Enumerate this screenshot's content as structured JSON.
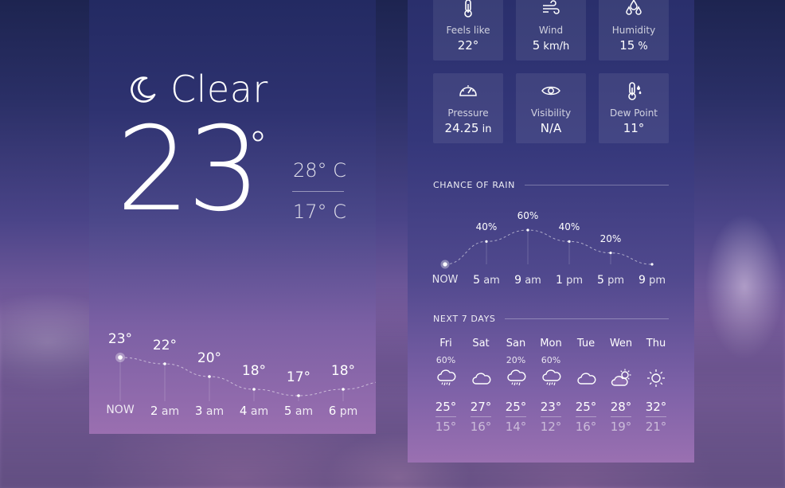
{
  "current": {
    "condition": "Clear",
    "icon": "moon-icon",
    "temperature": "23",
    "degree_symbol": "°",
    "high": "28° C",
    "low": "17° C"
  },
  "hourly": [
    {
      "temp": "23°",
      "time_num": "NOW",
      "time_unit": "",
      "value": 23
    },
    {
      "temp": "22°",
      "time_num": "2",
      "time_unit": "am",
      "value": 22
    },
    {
      "temp": "20°",
      "time_num": "3",
      "time_unit": "am",
      "value": 20
    },
    {
      "temp": "18°",
      "time_num": "4",
      "time_unit": "am",
      "value": 18
    },
    {
      "temp": "17°",
      "time_num": "5",
      "time_unit": "am",
      "value": 17
    },
    {
      "temp": "18°",
      "time_num": "6",
      "time_unit": "pm",
      "value": 18
    }
  ],
  "details": [
    {
      "label": "Feels like",
      "value": "22°",
      "unit": "",
      "icon": "thermometer-icon"
    },
    {
      "label": "Wind",
      "value": "5",
      "unit": "km/h",
      "icon": "wind-icon"
    },
    {
      "label": "Humidity",
      "value": "15",
      "unit": "%",
      "icon": "humidity-drops-icon"
    },
    {
      "label": "Pressure",
      "value": "24.25",
      "unit": "in",
      "icon": "gauge-icon"
    },
    {
      "label": "Visibility",
      "value": "N/A",
      "unit": "",
      "icon": "eye-icon"
    },
    {
      "label": "Dew Point",
      "value": "11°",
      "unit": "",
      "icon": "dew-thermometer-icon"
    }
  ],
  "rain": {
    "title": "CHANCE OF RAIN",
    "points": [
      {
        "label": "",
        "time_num": "NOW",
        "time_unit": "",
        "value": 0
      },
      {
        "label": "40%",
        "time_num": "5",
        "time_unit": "am",
        "value": 40
      },
      {
        "label": "60%",
        "time_num": "9",
        "time_unit": "am",
        "value": 60
      },
      {
        "label": "40%",
        "time_num": "1",
        "time_unit": "pm",
        "value": 40
      },
      {
        "label": "20%",
        "time_num": "5",
        "time_unit": "pm",
        "value": 20
      },
      {
        "label": "",
        "time_num": "9",
        "time_unit": "pm",
        "value": 0
      }
    ]
  },
  "week": {
    "title": "NEXT 7 DAYS",
    "days": [
      {
        "name": "Fri",
        "chance": "60%",
        "icon": "rain-cloud-icon",
        "hi": "25°",
        "lo": "15°"
      },
      {
        "name": "Sat",
        "chance": "",
        "icon": "cloud-icon",
        "hi": "27°",
        "lo": "16°"
      },
      {
        "name": "San",
        "chance": "20%",
        "icon": "rain-cloud-icon",
        "hi": "25°",
        "lo": "14°"
      },
      {
        "name": "Mon",
        "chance": "60%",
        "icon": "rain-cloud-icon",
        "hi": "23°",
        "lo": "12°"
      },
      {
        "name": "Tue",
        "chance": "",
        "icon": "cloud-icon",
        "hi": "25°",
        "lo": "16°"
      },
      {
        "name": "Wen",
        "chance": "",
        "icon": "partly-sunny-icon",
        "hi": "28°",
        "lo": "19°"
      },
      {
        "name": "Thu",
        "chance": "",
        "icon": "sun-icon",
        "hi": "32°",
        "lo": "21°"
      }
    ]
  }
}
